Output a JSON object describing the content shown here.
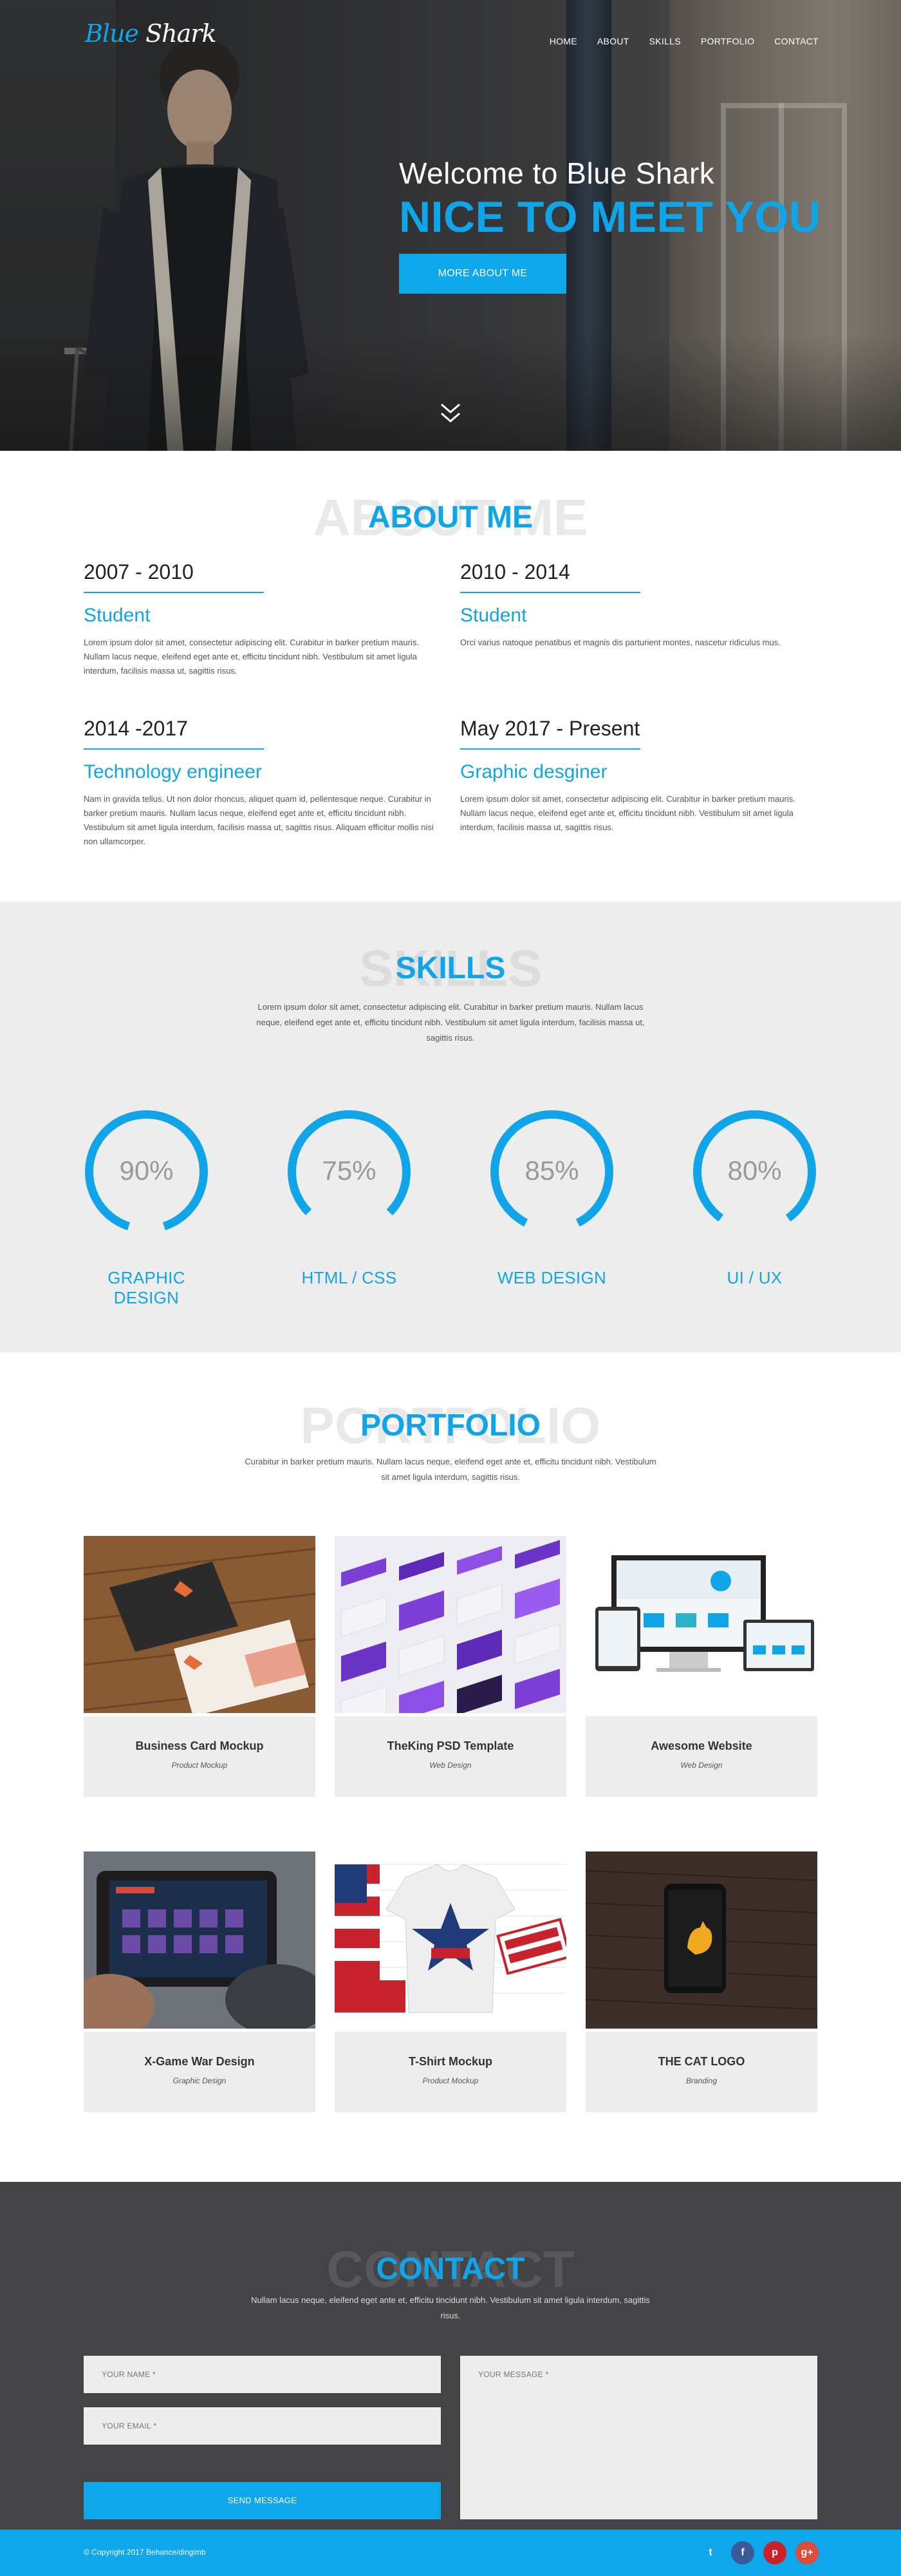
{
  "brand": {
    "logo_part1": "Blue",
    "logo_part2": "Shark"
  },
  "nav": {
    "items": [
      "HOME",
      "ABOUT",
      "SKILLS",
      "PORTFOLIO",
      "CONTACT"
    ]
  },
  "hero": {
    "subtitle": "Welcome to Blue Shark",
    "title": "NICE TO MEET YOU",
    "button": "MORE ABOUT ME"
  },
  "about": {
    "ghost": "ABOUT ME",
    "title": "ABOUT ME",
    "items": [
      {
        "year": "2007 - 2010",
        "role": "Student",
        "desc": "Lorem ipsum dolor sit amet, consectetur adipiscing elit. Curabitur in barker pretium mauris. Nullam lacus neque, eleifend eget ante et, efficitu tincidunt nibh. Vestibulum sit amet ligula interdum, facilisis massa ut, sagittis risus."
      },
      {
        "year": "2010 - 2014",
        "role": "Student",
        "desc": "Orci varius natoque penatibus et magnis dis parturient montes, nascetur ridiculus mus."
      },
      {
        "year": "2014 -2017",
        "role": "Technology engineer",
        "desc": "Nam in gravida tellus. Ut non dolor rhoncus, aliquet quam id, pellentesque neque. Curabitur in barker pretium mauris. Nullam lacus neque, eleifend eget ante et, efficitu tincidunt nibh. Vestibulum sit amet ligula interdum, facilisis massa ut, sagittis risus. Aliquam efficitur mollis nisi non ullamcorper."
      },
      {
        "year": "May 2017 - Present",
        "role": "Graphic desginer",
        "desc": "Lorem ipsum dolor sit amet, consectetur adipiscing elit. Curabitur in barker pretium mauris. Nullam lacus neque, eleifend eget ante et, efficitu tincidunt nibh. Vestibulum sit amet ligula interdum, facilisis massa ut, sagittis risus."
      }
    ]
  },
  "skills": {
    "ghost": "SKILLS",
    "title": "SKILLS",
    "desc": "Lorem ipsum dolor sit amet, consectetur adipiscing elit. Curabitur in barker pretium mauris. Nullam lacus neque, eleifend eget ante et, efficitu tincidunt nibh. Vestibulum sit amet ligula interdum, facilisis massa ut, sagittis risus.",
    "items": [
      {
        "name": "GRAPHIC DESIGN",
        "percent_label": "90%",
        "value": 90
      },
      {
        "name": "HTML / CSS",
        "percent_label": "75%",
        "value": 75
      },
      {
        "name": "WEB DESIGN",
        "percent_label": "85%",
        "value": 85
      },
      {
        "name": "UI / UX",
        "percent_label": "80%",
        "value": 80
      }
    ],
    "accent": "#10a5e8"
  },
  "portfolio": {
    "ghost": "PORTFOLIO",
    "title": "PORTFOLIO",
    "desc": "Curabitur in barker pretium mauris. Nullam lacus neque, eleifend eget ante et, efficitu tincidunt nibh. Vestibulum sit amet ligula interdum, sagittis risus.",
    "items": [
      {
        "title": "Business Card Mockup",
        "category": "Product Mockup"
      },
      {
        "title": "TheKing PSD Template",
        "category": "Web Design"
      },
      {
        "title": "Awesome Website",
        "category": "Web Design"
      },
      {
        "title": "X-Game War Design",
        "category": "Graphic Design"
      },
      {
        "title": "T-Shirt Mockup",
        "category": "Product Mockup"
      },
      {
        "title": "THE CAT LOGO",
        "category": "Branding"
      }
    ]
  },
  "contact": {
    "ghost": "CONTACT",
    "title": "CONTACT",
    "desc": "Nullam lacus neque, eleifend eget ante et, efficitu tincidunt nibh. Vestibulum sit amet ligula interdum, sagittis risus.",
    "name_placeholder": "YOUR NAME *",
    "email_placeholder": "YOUR EMAIL *",
    "message_placeholder": "YOUR MESSAGE *",
    "send": "SEND MESSAGE"
  },
  "footer": {
    "copyright": "© Copyright 2017 Behance/dingimb",
    "socials": [
      {
        "icon": "twitter-icon",
        "glyph": "t",
        "color": "#0ea7ec"
      },
      {
        "icon": "facebook-icon",
        "glyph": "f",
        "color": "#3b5998"
      },
      {
        "icon": "pinterest-icon",
        "glyph": "p",
        "color": "#cb2027"
      },
      {
        "icon": "google-plus-icon",
        "glyph": "g+",
        "color": "#dd4b39"
      }
    ]
  }
}
